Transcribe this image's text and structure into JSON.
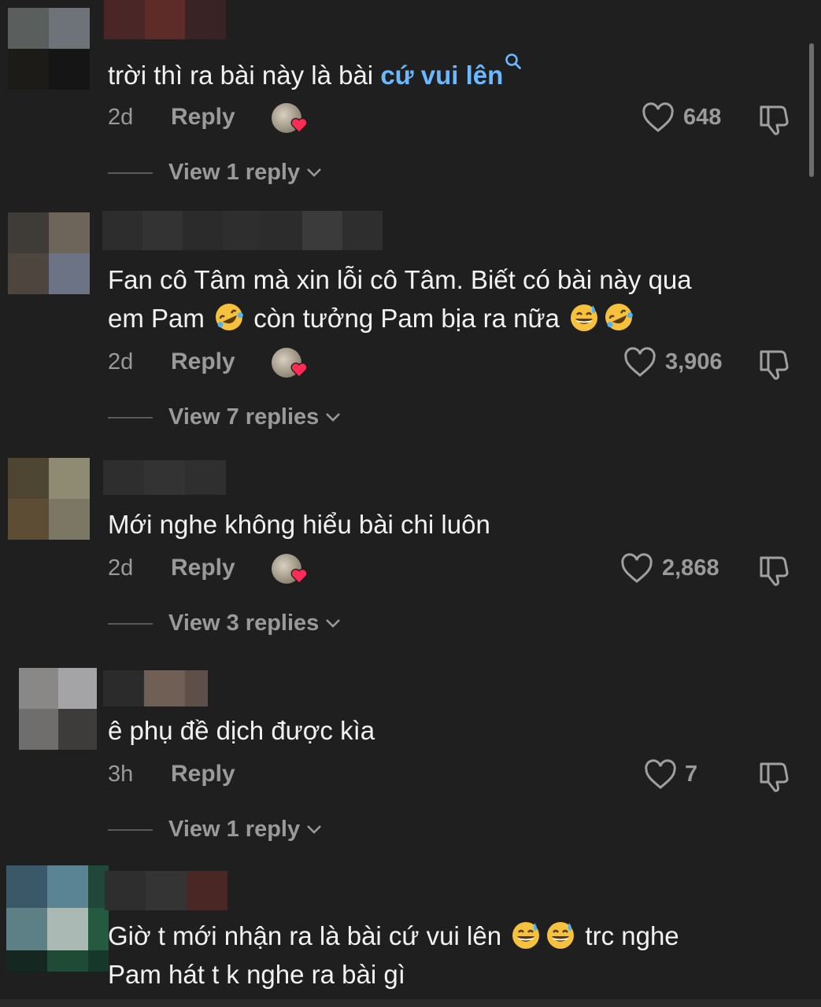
{
  "comments": [
    {
      "text_before": "trời thì ra bài này là bài ",
      "text_link": "cứ vui lên",
      "time": "2d",
      "reply_label": "Reply",
      "likes": "648",
      "view_replies": "View 1 reply"
    },
    {
      "line1": "Fan cô Tâm mà xin lỗi cô Tâm. Biết có bài này qua",
      "line2_a": "em Pam ",
      "line2_b": " còn tưởng Pam bịa ra nữa ",
      "time": "2d",
      "reply_label": "Reply",
      "likes": "3,906",
      "view_replies": "View 7 replies"
    },
    {
      "text": "Mới nghe không hiểu bài chi luôn",
      "time": "2d",
      "reply_label": "Reply",
      "likes": "2,868",
      "view_replies": "View 3 replies"
    },
    {
      "text": "ê phụ đề dịch được kìa",
      "time": "3h",
      "reply_label": "Reply",
      "likes": "7",
      "view_replies": "View 1 reply"
    },
    {
      "line1_a": "Giờ t mới nhận ra là bài cứ vui lên ",
      "line1_b": " trc nghe",
      "line2": "Pam hát t k nghe ra bài gì"
    }
  ],
  "icons": {
    "like": "heart-outline-icon",
    "dislike": "thumbs-down-icon",
    "search": "search-icon",
    "chevron": "chevron-down-icon",
    "emoji_laugh": "rolling-on-floor-laughing-emoji",
    "emoji_sweat": "grinning-sweat-emoji"
  },
  "colors": {
    "background": "#1f1f1f",
    "link": "#6cb8ff",
    "muted": "#9a9a9a",
    "creator_heart": "#fe2c55"
  }
}
